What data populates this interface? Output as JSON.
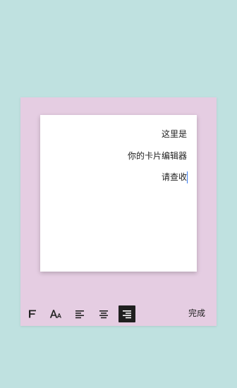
{
  "editor": {
    "card_lines": [
      "这里是",
      "你的卡片编辑器",
      "请查收"
    ]
  },
  "toolbar": {
    "tools": [
      {
        "name": "font-style",
        "icon": "font-f-icon"
      },
      {
        "name": "font-size",
        "icon": "font-size-icon"
      },
      {
        "name": "align-left",
        "icon": "align-left-icon"
      },
      {
        "name": "align-center",
        "icon": "align-center-icon"
      },
      {
        "name": "align-right",
        "icon": "align-right-icon",
        "selected": true
      }
    ],
    "done_label": "完成"
  },
  "colors": {
    "background": "#bfe1e0",
    "panel": "#e5cde2",
    "card": "#ffffff",
    "caret": "#3a7cf0",
    "selected_tool": "#1f1f1f"
  }
}
